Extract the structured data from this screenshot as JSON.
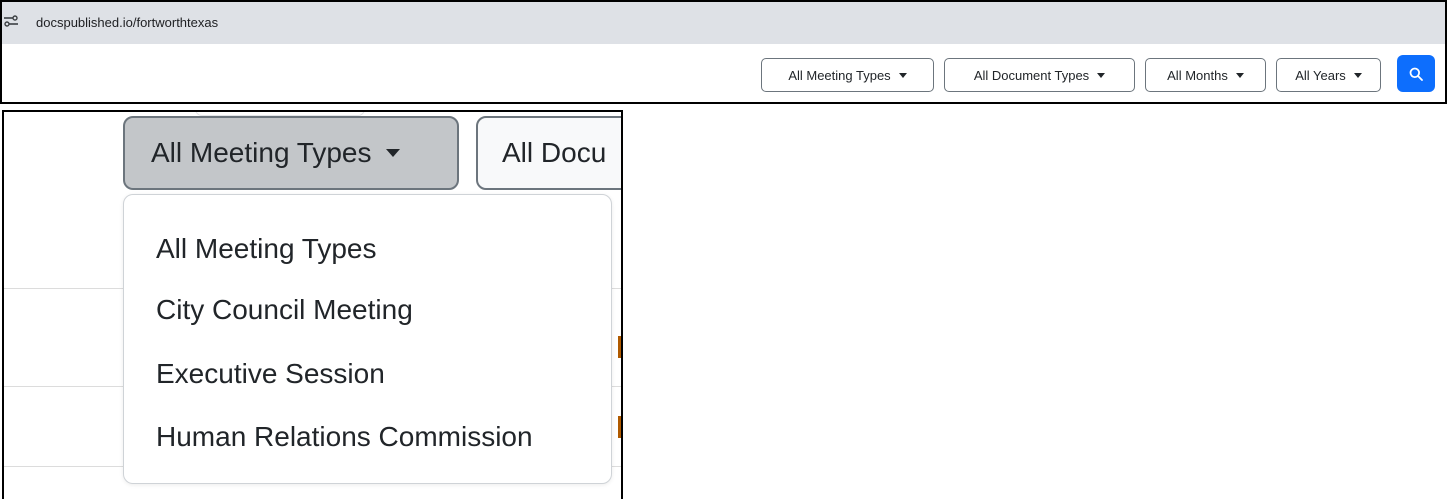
{
  "browser": {
    "url": "docspublished.io/fortworthtexas",
    "site_icon": "site-settings-icon"
  },
  "filters": {
    "meeting_types": "All Meeting Types",
    "document_types": "All Document Types",
    "months": "All Months",
    "years": "All Years",
    "search_icon": "search-icon",
    "search_color": "#0d6efd"
  },
  "zoom": {
    "active_button": "All Meeting Types",
    "next_button_partial": "All Docu",
    "dropdown_items": [
      "All Meeting Types",
      "City Council Meeting",
      "Executive Session",
      "Human Relations Commission"
    ]
  }
}
